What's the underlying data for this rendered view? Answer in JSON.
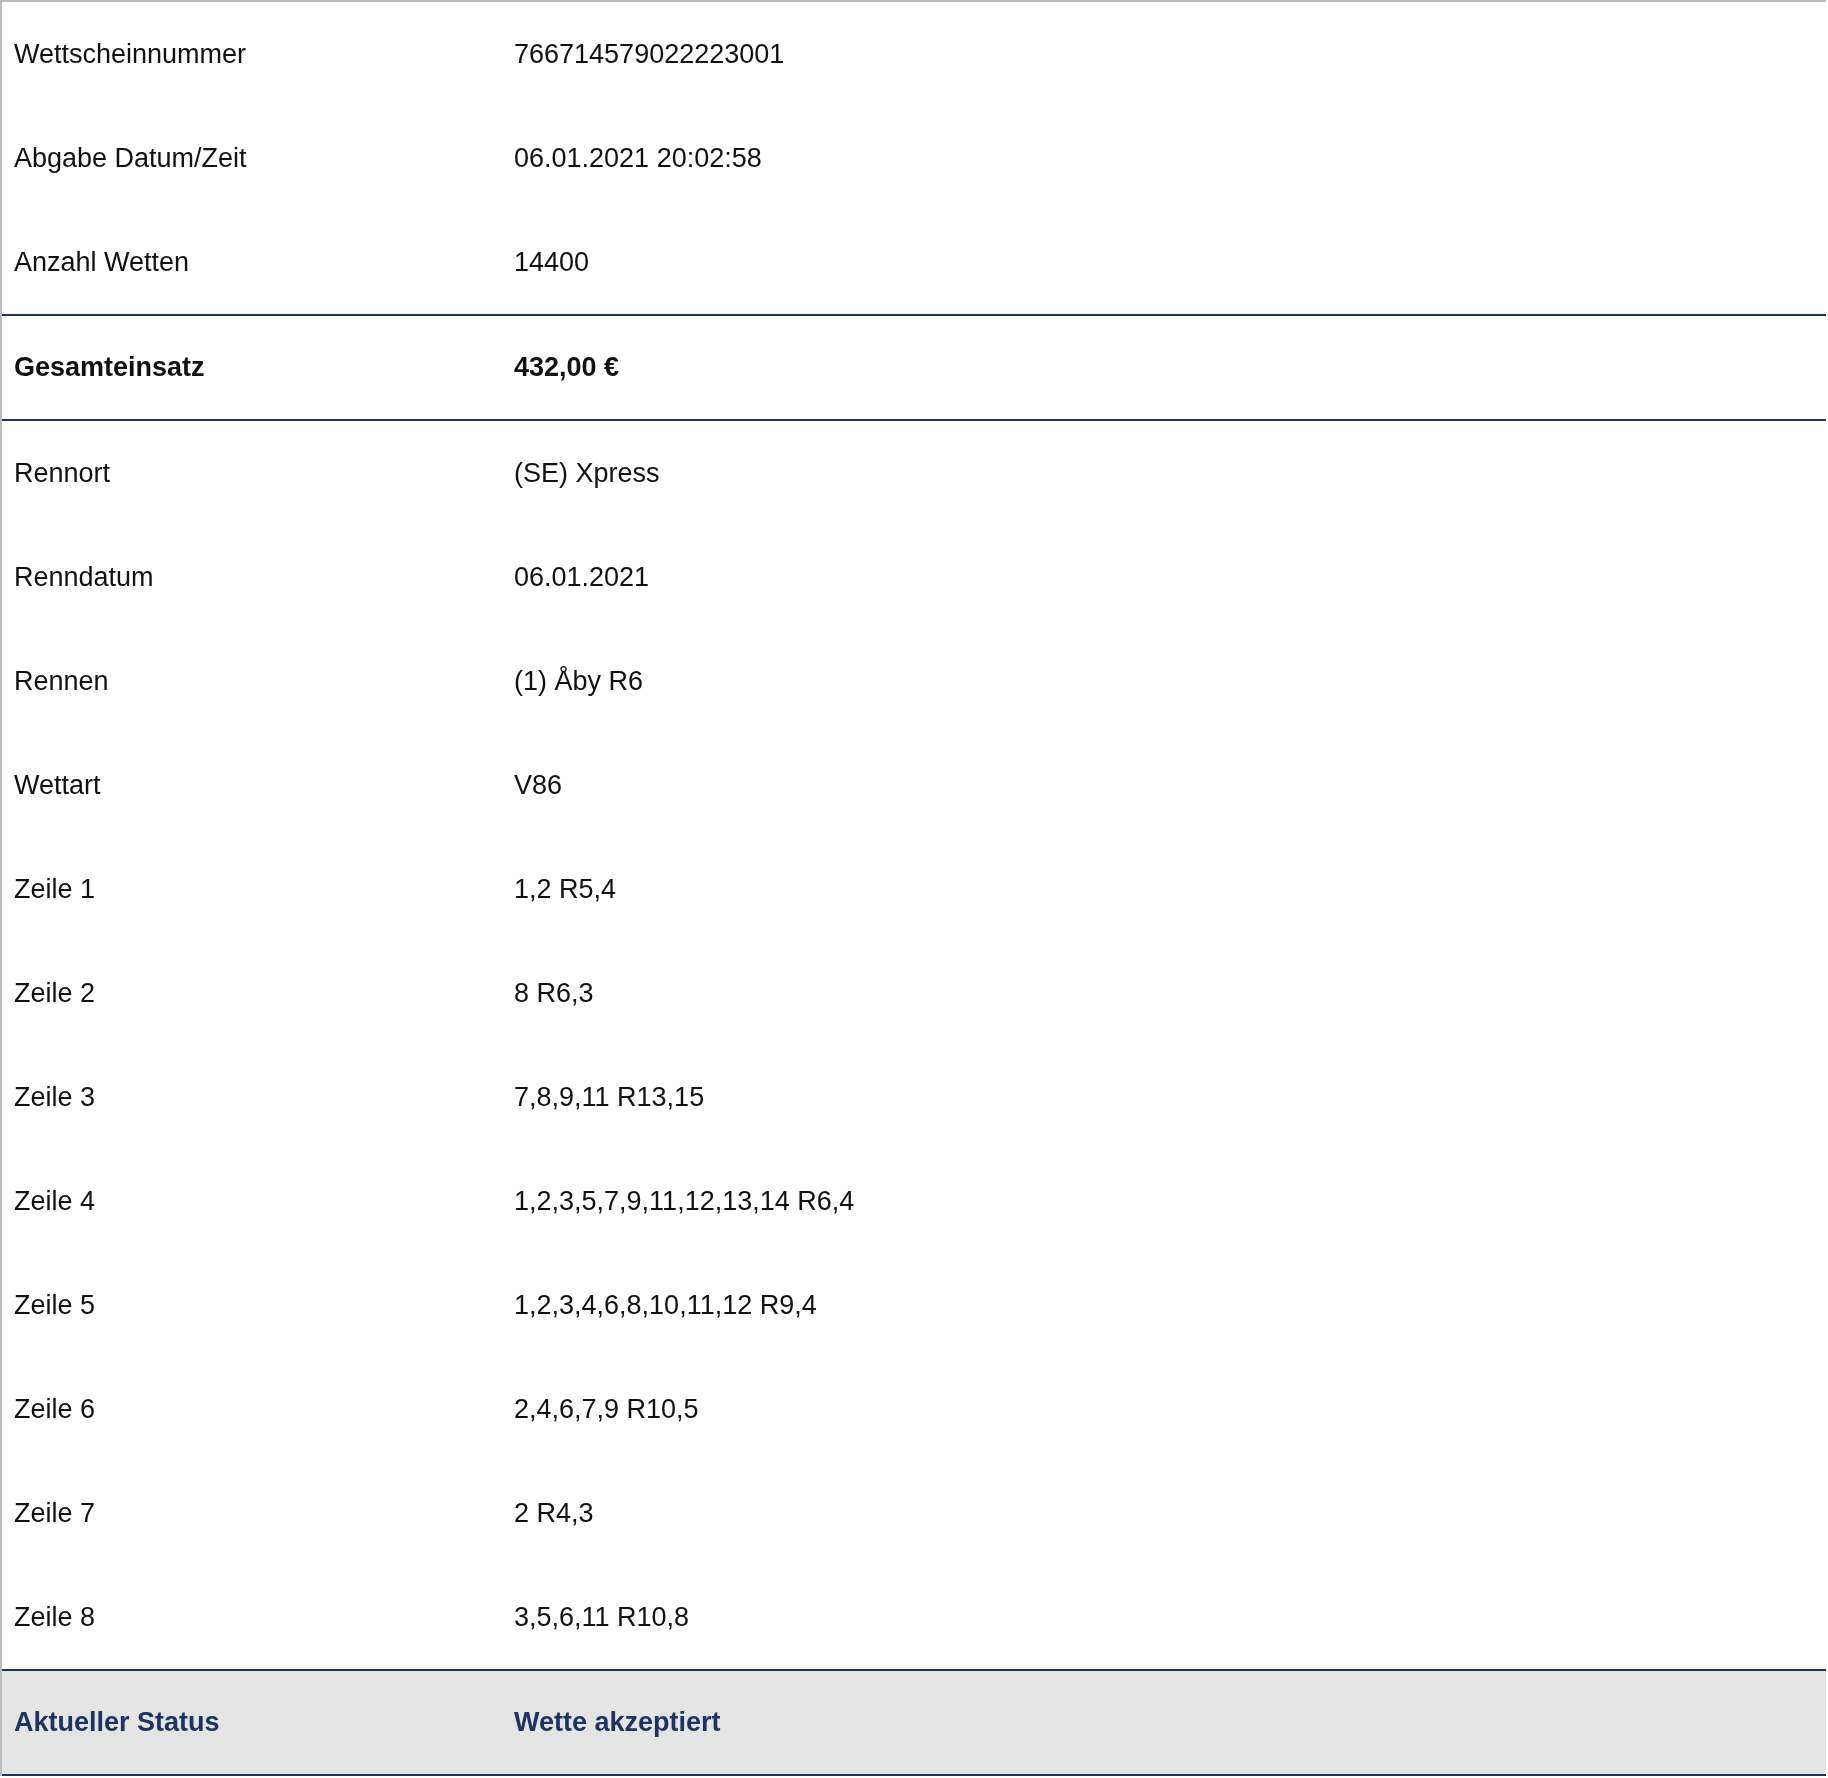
{
  "rows": [
    {
      "kind": "plain",
      "label": "Wettscheinnummer",
      "value": "766714579022223001"
    },
    {
      "kind": "plain",
      "label": "Abgabe Datum/Zeit",
      "value": "06.01.2021 20:02:58"
    },
    {
      "kind": "plain",
      "label": "Anzahl Wetten",
      "value": "14400"
    },
    {
      "kind": "total",
      "label": "Gesamteinsatz",
      "value": "432,00 €"
    },
    {
      "kind": "plain",
      "label": "Rennort",
      "value": "(SE) Xpress"
    },
    {
      "kind": "plain",
      "label": "Renndatum",
      "value": "06.01.2021"
    },
    {
      "kind": "plain",
      "label": "Rennen",
      "value": "(1) Åby R6"
    },
    {
      "kind": "plain",
      "label": "Wettart",
      "value": "V86"
    },
    {
      "kind": "plain",
      "label": "Zeile 1",
      "value": "1,2 R5,4"
    },
    {
      "kind": "plain",
      "label": "Zeile 2",
      "value": "8 R6,3"
    },
    {
      "kind": "plain",
      "label": "Zeile 3",
      "value": "7,8,9,11 R13,15"
    },
    {
      "kind": "plain",
      "label": "Zeile 4",
      "value": "1,2,3,5,7,9,11,12,13,14 R6,4"
    },
    {
      "kind": "plain",
      "label": "Zeile 5",
      "value": "1,2,3,4,6,8,10,11,12 R9,4"
    },
    {
      "kind": "plain",
      "label": "Zeile 6",
      "value": "2,4,6,7,9 R10,5"
    },
    {
      "kind": "plain",
      "label": "Zeile 7",
      "value": "2 R4,3"
    },
    {
      "kind": "plain",
      "label": "Zeile 8",
      "value": "3,5,6,11 R10,8"
    },
    {
      "kind": "status",
      "label": "Aktueller Status",
      "value": "Wette akzeptiert"
    }
  ]
}
